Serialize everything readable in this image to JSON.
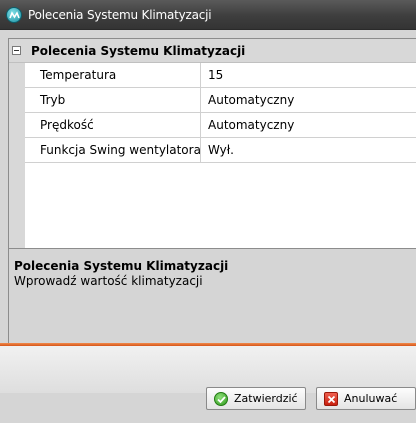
{
  "window": {
    "title": "Polecenia Systemu Klimatyzacji"
  },
  "grid": {
    "category": "Polecenia Systemu Klimatyzacji",
    "properties": [
      {
        "name": "Temperatura",
        "value": "15"
      },
      {
        "name": "Tryb",
        "value": "Automatyczny"
      },
      {
        "name": "Prędkość",
        "value": "Automatyczny"
      },
      {
        "name": "Funkcja Swing wentylatora",
        "value": "Wył."
      }
    ]
  },
  "description": {
    "title": "Polecenia Systemu Klimatyzacji",
    "text": "Wprowadź wartość klimatyzacji"
  },
  "footer": {
    "confirm_label": "Zatwierdzić",
    "cancel_label": "Anuluwać"
  },
  "colors": {
    "titlebar": "#3e3e3e",
    "separator": "#e6702f",
    "panel": "#d5d5d5"
  }
}
